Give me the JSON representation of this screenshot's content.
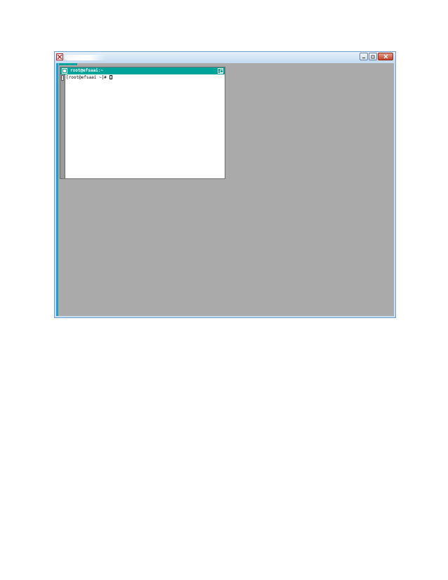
{
  "colors": {
    "window_frame": "#c9ddf0",
    "desktop_background": "#aaaaaa",
    "xterm_titlebar": "#00a39a",
    "close_button": "#c3432b"
  },
  "outer_window": {
    "app_icon": "x-logo-icon",
    "controls": {
      "minimize_icon": "minimize-icon",
      "maximize_icon": "maximize-icon",
      "close_icon": "close-icon"
    }
  },
  "xterm": {
    "title": "root@efsaai:~",
    "window_menu_icon": "window-menu-icon",
    "maximize_icon": "maximize-icon",
    "prompt": "[root@efsaai ~]# "
  }
}
